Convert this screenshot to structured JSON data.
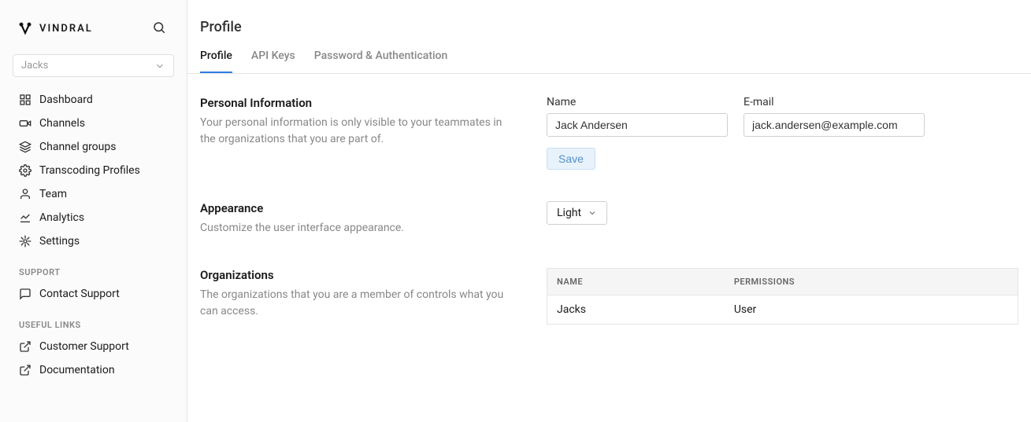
{
  "brand": "VINDRAL",
  "org_selector": {
    "label": "Jacks"
  },
  "sidebar": {
    "main": [
      {
        "label": "Dashboard"
      },
      {
        "label": "Channels"
      },
      {
        "label": "Channel groups"
      },
      {
        "label": "Transcoding Profiles"
      },
      {
        "label": "Team"
      },
      {
        "label": "Analytics"
      },
      {
        "label": "Settings"
      }
    ],
    "support_heading": "SUPPORT",
    "support": [
      {
        "label": "Contact Support"
      }
    ],
    "links_heading": "USEFUL LINKS",
    "links": [
      {
        "label": "Customer Support"
      },
      {
        "label": "Documentation"
      }
    ]
  },
  "page": {
    "title": "Profile",
    "tabs": [
      {
        "label": "Profile",
        "active": true
      },
      {
        "label": "API Keys",
        "active": false
      },
      {
        "label": "Password & Authentication",
        "active": false
      }
    ]
  },
  "sections": {
    "personal": {
      "title": "Personal Information",
      "desc": "Your personal information is only visible to your teammates in the organizations that you are part of.",
      "name_label": "Name",
      "name_value": "Jack Andersen",
      "email_label": "E-mail",
      "email_value": "jack.andersen@example.com",
      "save_label": "Save"
    },
    "appearance": {
      "title": "Appearance",
      "desc": "Customize the user interface appearance.",
      "theme_value": "Light"
    },
    "organizations": {
      "title": "Organizations",
      "desc": "The organizations that you are a member of controls what you can access.",
      "col_name": "NAME",
      "col_permissions": "PERMISSIONS",
      "rows": [
        {
          "name": "Jacks",
          "permissions": "User"
        }
      ]
    }
  }
}
